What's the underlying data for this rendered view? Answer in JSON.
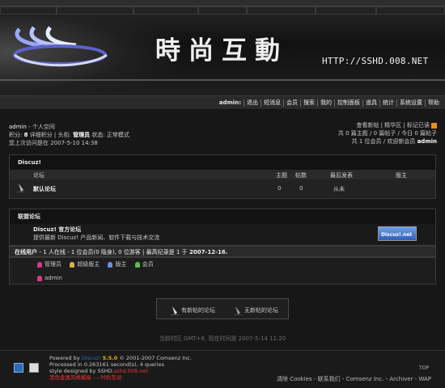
{
  "banner": {
    "title": "時尚互動",
    "url": "HTTP://SSHD.008.NET",
    "logo_name": "sshd-logo"
  },
  "nav": {
    "items": [
      "admin:",
      "退出",
      "短消息",
      "会员",
      "搜索",
      "我的",
      "控制面板",
      "道具",
      "统计",
      "系统设置",
      "帮助"
    ]
  },
  "user": {
    "name": "admin",
    "space": "- 个人空间",
    "line2_label1": "积分:",
    "credits": "8",
    "line2_label2": "详细积分 | 头衔:",
    "rank": "管理员",
    "line2_label3": "状态: 正常模式",
    "last_visit": "您上次访问是在 2007-5-10 14:38"
  },
  "stats": {
    "links": "查看新帖 | 精华区 | 标记已读",
    "line2": "共 0 篇主题 / 0 篇帖子 / 今日 0 篇帖子",
    "line3_prefix": "共 1 位会员 / 欢迎新会员",
    "newest": "admin"
  },
  "forum_block": {
    "title": "Discuz!",
    "col_forum": "论坛",
    "col_topics": "主题",
    "col_posts": "帖数",
    "col_last": "最后发表",
    "col_mod": "版主",
    "forum_name": "默认论坛",
    "topics": "0",
    "posts": "0",
    "last": "从未"
  },
  "links_block": {
    "title": "联盟论坛",
    "name": "Discuz! 官方论坛",
    "desc": "提供最新 Discuz! 产品新闻、软件下载与技术交流",
    "badge": "Discuz!.net"
  },
  "online": {
    "title": "在线用户",
    "summary_prefix": "- 1 人在线 - 1 位会员(0 隐身), 0 位游客 | 最高纪录是 1 于",
    "record_date": "2007-12-16.",
    "legend": [
      "管理员",
      "超级版主",
      "版主",
      "会员"
    ],
    "legend_colors": [
      "#d63a8a",
      "#d8b33c",
      "#6a8fe0",
      "#5cc04a"
    ],
    "user": "admin"
  },
  "notice": {
    "new_posts": "有新帖的论坛",
    "no_new_posts": "无新帖的论坛"
  },
  "timezone": "当前时区 GMT+8, 现在时间是 2007-5-14 11:20",
  "footer": {
    "powered_prefix": "Powered by",
    "brand": "Discuz!",
    "version": "5.5.0",
    "copyright": "© 2001-2007 Comsenz Inc.",
    "processed": "Processed in 0.263161 second(s), 4 queries",
    "designed_prefix": "style designed by SSHD.",
    "designed_site": "sshd.008.net",
    "red_line": "黑色金属风格模板 --- 时尚互动",
    "links": "清除 Cookies - 联系我们 - Comsenz Inc. - Archiver - WAP",
    "top": "TOP"
  }
}
